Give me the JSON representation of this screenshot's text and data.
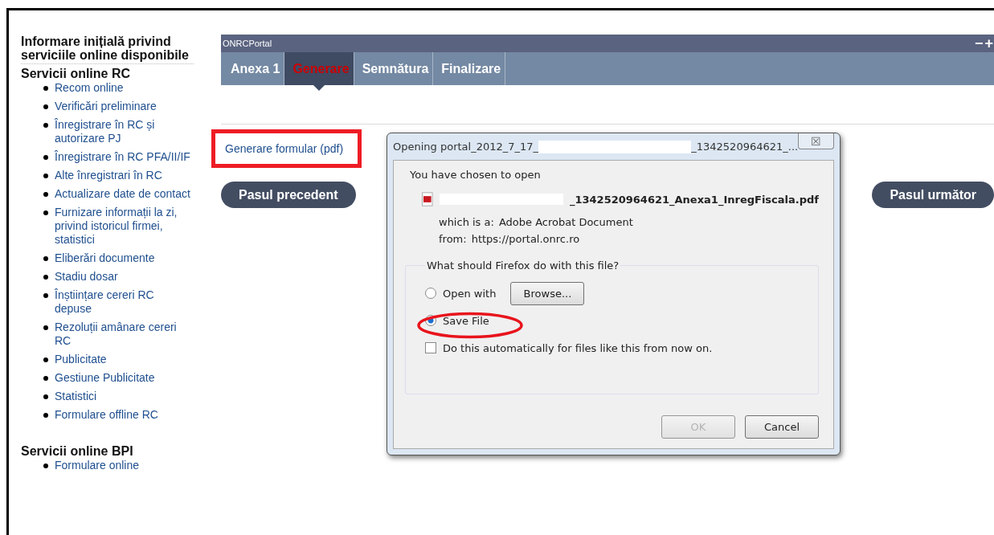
{
  "sidebar": {
    "intro_heading": "Informare inițială privind serviciile online disponibile",
    "sections": [
      {
        "title": "Servicii online RC",
        "items": [
          "Recom online",
          "Verificări preliminare",
          "Înregistrare în RC și autorizare PJ",
          "Înregistrare în RC PFA/II/IF",
          "Alte înregistrari în RC",
          "Actualizare date de contact",
          "Furnizare informații la zi, privind istoricul firmei, statistici",
          "Eliberări documente",
          "Stadiu dosar",
          "Înștiințare cereri RC depuse",
          "Rezoluții amânare cereri RC",
          "Publicitate",
          "Gestiune Publicitate",
          "Statistici",
          "Formulare offline RC"
        ]
      },
      {
        "title": "Servicii online BPI",
        "items": [
          "Formulare online"
        ]
      }
    ]
  },
  "portal": {
    "title": "ONRCPortal",
    "window_controls": [
      "−",
      "+"
    ],
    "tabs": [
      {
        "label": "Anexa 1",
        "selected": false
      },
      {
        "label": "Generare",
        "selected": true
      },
      {
        "label": "Semnătura",
        "selected": false
      },
      {
        "label": "Finalizare",
        "selected": false
      }
    ],
    "link": "Generare formular (pdf)",
    "link_highlighted": true,
    "buttons": [
      "Pasul precedent",
      "Pasul următor"
    ]
  },
  "dialog": {
    "title_start": "Opening portal_2012_7_17_",
    "title_end": "_1342520964621_...",
    "close": "☒",
    "intro": "You have chosen to open",
    "file_name": "_1342520964621_Anexa1_InregFiscala.pdf",
    "type_label": "which is a:",
    "type_value": "Adobe Acrobat Document",
    "from_label": "from:",
    "from_value": "https://portal.onrc.ro",
    "group_title": "What should Firefox do with this file?",
    "options": [
      {
        "label": "Open with",
        "selected": false,
        "button": "Browse..."
      },
      {
        "label": "Save File",
        "selected": true,
        "circled": true
      }
    ],
    "auto_checkbox": {
      "label": "Do this automatically for files like this from now on.",
      "checked": false
    },
    "ok": {
      "label": "OK",
      "disabled": true
    },
    "cancel": {
      "label": "Cancel",
      "disabled": false
    }
  }
}
